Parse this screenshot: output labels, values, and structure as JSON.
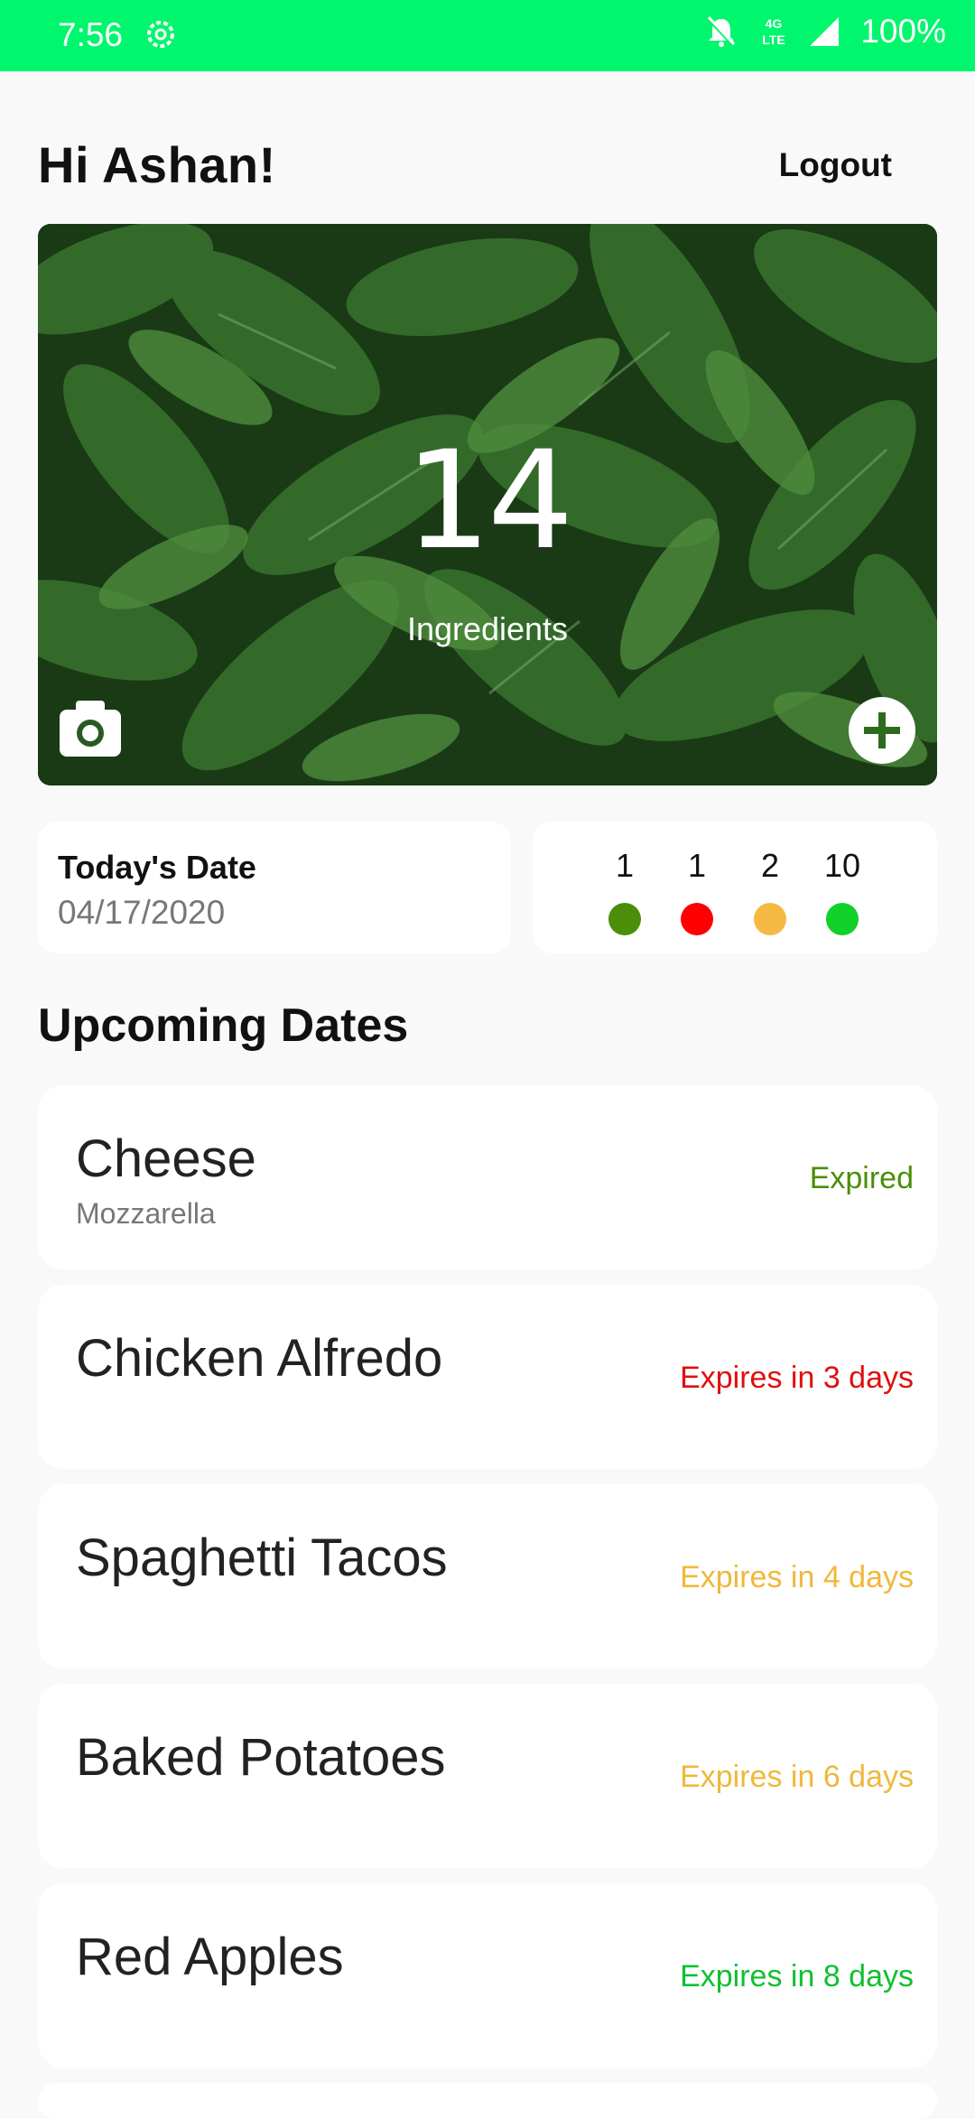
{
  "status_bar": {
    "time": "7:56",
    "network": "4G LTE",
    "battery": "100%",
    "icons": [
      "gear-icon",
      "bell-off-icon",
      "signal-icon"
    ]
  },
  "header": {
    "greeting": "Hi Ashan!",
    "logout_label": "Logout"
  },
  "hero": {
    "count": "14",
    "label": "Ingredients",
    "icons": [
      "camera-icon",
      "plus-icon"
    ]
  },
  "date_card": {
    "title": "Today's Date",
    "value": "04/17/2020"
  },
  "counts": [
    {
      "value": "1",
      "color": "#4a8e0a"
    },
    {
      "value": "1",
      "color": "#ff0000"
    },
    {
      "value": "2",
      "color": "#f5b942"
    },
    {
      "value": "10",
      "color": "#10d02a"
    }
  ],
  "upcoming": {
    "title": "Upcoming Dates",
    "items": [
      {
        "name": "Cheese",
        "sub": "Mozzarella",
        "status": "Expired",
        "color": "#4a8e0a"
      },
      {
        "name": "Chicken Alfredo",
        "sub": "",
        "status": "Expires in 3 days",
        "color": "#e01010"
      },
      {
        "name": "Spaghetti Tacos",
        "sub": "",
        "status": "Expires in 4 days",
        "color": "#f0b83a"
      },
      {
        "name": "Baked Potatoes",
        "sub": "",
        "status": "Expires in 6 days",
        "color": "#f0b83a"
      },
      {
        "name": "Red Apples",
        "sub": "",
        "status": "Expires in 8 days",
        "color": "#10c030"
      }
    ]
  }
}
